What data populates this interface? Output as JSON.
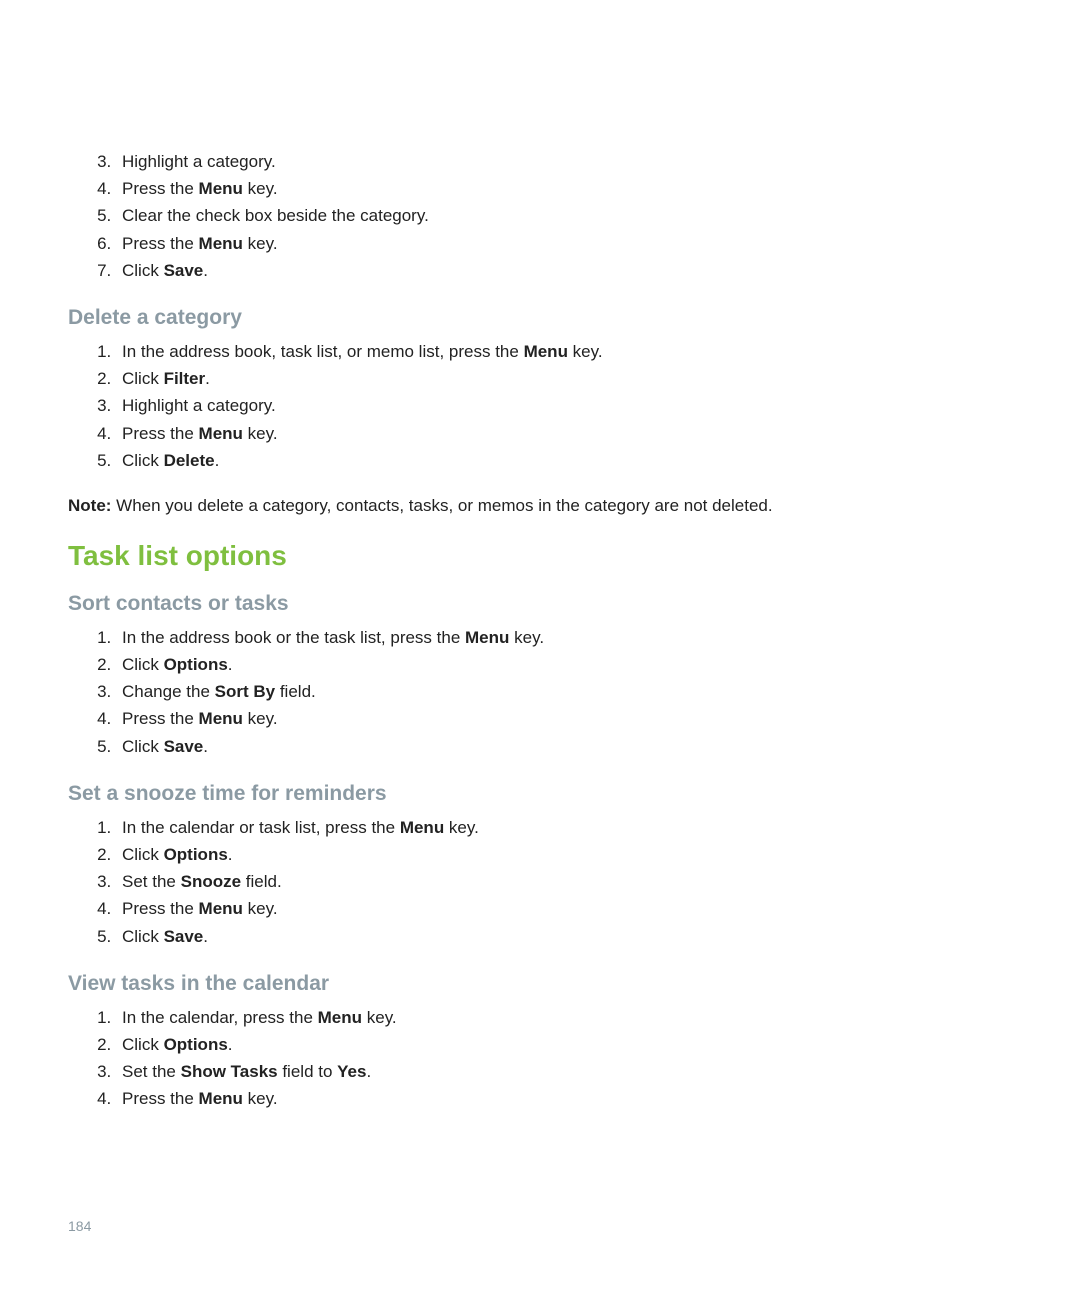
{
  "topList": {
    "start": 3,
    "items": [
      {
        "segments": [
          {
            "t": "Highlight a category.",
            "b": false
          }
        ]
      },
      {
        "segments": [
          {
            "t": "Press the ",
            "b": false
          },
          {
            "t": "Menu",
            "b": true
          },
          {
            "t": " key.",
            "b": false
          }
        ]
      },
      {
        "segments": [
          {
            "t": "Clear the check box beside the category.",
            "b": false
          }
        ]
      },
      {
        "segments": [
          {
            "t": "Press the ",
            "b": false
          },
          {
            "t": "Menu",
            "b": true
          },
          {
            "t": " key.",
            "b": false
          }
        ]
      },
      {
        "segments": [
          {
            "t": "Click ",
            "b": false
          },
          {
            "t": "Save",
            "b": true
          },
          {
            "t": ".",
            "b": false
          }
        ]
      }
    ]
  },
  "sections": [
    {
      "heading": "Delete a category",
      "listStart": 1,
      "items": [
        {
          "segments": [
            {
              "t": "In the address book, task list, or memo list, press the ",
              "b": false
            },
            {
              "t": "Menu",
              "b": true
            },
            {
              "t": " key.",
              "b": false
            }
          ]
        },
        {
          "segments": [
            {
              "t": "Click ",
              "b": false
            },
            {
              "t": "Filter",
              "b": true
            },
            {
              "t": ".",
              "b": false
            }
          ]
        },
        {
          "segments": [
            {
              "t": "Highlight a category.",
              "b": false
            }
          ]
        },
        {
          "segments": [
            {
              "t": "Press the ",
              "b": false
            },
            {
              "t": "Menu",
              "b": true
            },
            {
              "t": " key.",
              "b": false
            }
          ]
        },
        {
          "segments": [
            {
              "t": "Click ",
              "b": false
            },
            {
              "t": "Delete",
              "b": true
            },
            {
              "t": ".",
              "b": false
            }
          ]
        }
      ],
      "noteLabel": "Note:",
      "noteBody": "  When you delete a category, contacts, tasks, or memos in the category are not deleted."
    }
  ],
  "mainHeading": "Task list options",
  "subSections": [
    {
      "heading": "Sort contacts or tasks",
      "listStart": 1,
      "items": [
        {
          "segments": [
            {
              "t": "In the address book or the task list, press the ",
              "b": false
            },
            {
              "t": "Menu",
              "b": true
            },
            {
              "t": " key.",
              "b": false
            }
          ]
        },
        {
          "segments": [
            {
              "t": "Click ",
              "b": false
            },
            {
              "t": "Options",
              "b": true
            },
            {
              "t": ".",
              "b": false
            }
          ]
        },
        {
          "segments": [
            {
              "t": "Change the ",
              "b": false
            },
            {
              "t": "Sort By",
              "b": true
            },
            {
              "t": " field.",
              "b": false
            }
          ]
        },
        {
          "segments": [
            {
              "t": "Press the ",
              "b": false
            },
            {
              "t": "Menu",
              "b": true
            },
            {
              "t": " key.",
              "b": false
            }
          ]
        },
        {
          "segments": [
            {
              "t": "Click ",
              "b": false
            },
            {
              "t": "Save",
              "b": true
            },
            {
              "t": ".",
              "b": false
            }
          ]
        }
      ]
    },
    {
      "heading": "Set a snooze time for reminders",
      "listStart": 1,
      "items": [
        {
          "segments": [
            {
              "t": "In the calendar or task list, press the ",
              "b": false
            },
            {
              "t": "Menu",
              "b": true
            },
            {
              "t": " key.",
              "b": false
            }
          ]
        },
        {
          "segments": [
            {
              "t": "Click ",
              "b": false
            },
            {
              "t": "Options",
              "b": true
            },
            {
              "t": ".",
              "b": false
            }
          ]
        },
        {
          "segments": [
            {
              "t": "Set the ",
              "b": false
            },
            {
              "t": "Snooze",
              "b": true
            },
            {
              "t": " field.",
              "b": false
            }
          ]
        },
        {
          "segments": [
            {
              "t": "Press the ",
              "b": false
            },
            {
              "t": "Menu",
              "b": true
            },
            {
              "t": " key.",
              "b": false
            }
          ]
        },
        {
          "segments": [
            {
              "t": "Click ",
              "b": false
            },
            {
              "t": "Save",
              "b": true
            },
            {
              "t": ".",
              "b": false
            }
          ]
        }
      ]
    },
    {
      "heading": "View tasks in the calendar",
      "listStart": 1,
      "items": [
        {
          "segments": [
            {
              "t": "In the calendar, press the ",
              "b": false
            },
            {
              "t": "Menu",
              "b": true
            },
            {
              "t": " key.",
              "b": false
            }
          ]
        },
        {
          "segments": [
            {
              "t": "Click ",
              "b": false
            },
            {
              "t": "Options",
              "b": true
            },
            {
              "t": ".",
              "b": false
            }
          ]
        },
        {
          "segments": [
            {
              "t": "Set the ",
              "b": false
            },
            {
              "t": "Show Tasks",
              "b": true
            },
            {
              "t": " field to ",
              "b": false
            },
            {
              "t": "Yes",
              "b": true
            },
            {
              "t": ".",
              "b": false
            }
          ]
        },
        {
          "segments": [
            {
              "t": "Press the ",
              "b": false
            },
            {
              "t": "Menu",
              "b": true
            },
            {
              "t": " key.",
              "b": false
            }
          ]
        }
      ]
    }
  ],
  "pageNumber": "184"
}
